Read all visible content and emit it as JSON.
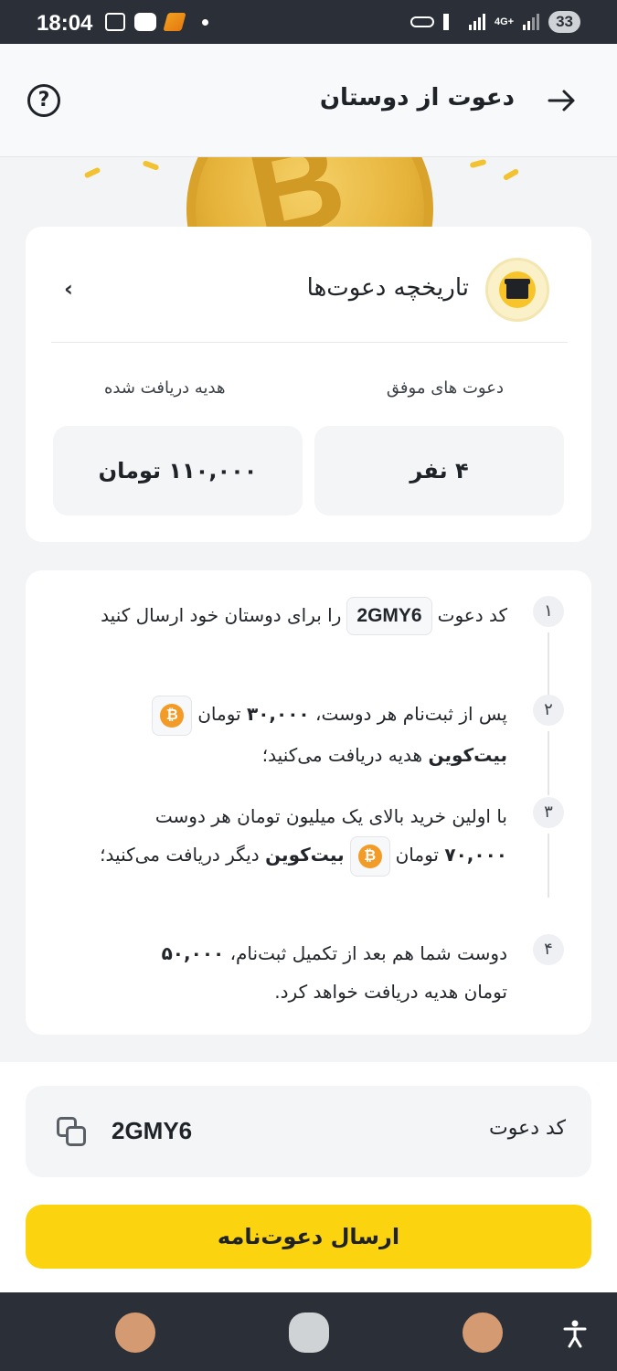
{
  "status_bar": {
    "time": "18:04",
    "network": "4G+",
    "battery": "33"
  },
  "header": {
    "title": "دعوت از دوستان",
    "back_icon": "arrow-right-icon",
    "help_icon": "question-circle-icon"
  },
  "history": {
    "title": "تاریخچه دعوت‌ها",
    "icon": "gift-icon",
    "stats": {
      "successful_label": "دعوت های موفق",
      "successful_value": "۴ نفر",
      "received_label": "هدیه دریافت شده",
      "received_value": "۱۱۰,۰۰۰ تومان"
    }
  },
  "steps": [
    {
      "num": "۱",
      "part1": "کد دعوت",
      "code": "2GMY6",
      "part2": "را برای دوستان خود ارسال کنید"
    },
    {
      "num": "۲",
      "part1": "پس از ثبت‌نام هر دوست،",
      "amount": "۳۰,۰۰۰",
      "part2": "تومان",
      "coin": "بیت‌کوین",
      "part3": "هدیه دریافت می‌کنید؛"
    },
    {
      "num": "۳",
      "part1": "با اولین خرید بالای یک میلیون تومان هر دوست",
      "amount": "۷۰,۰۰۰",
      "part2": "تومان",
      "coin": "بیت‌کوین",
      "part3": "دیگر دریافت می‌کنید؛"
    },
    {
      "num": "۴",
      "part1": "دوست شما هم بعد از تکمیل ثبت‌نام،",
      "amount": "۵۰,۰۰۰",
      "part2": "تومان هدیه دریافت خواهد کرد."
    }
  ],
  "invite_code": {
    "label": "کد دعوت",
    "value": "2GMY6",
    "copy_icon": "copy-icon"
  },
  "send_button": "ارسال دعوت‌نامه",
  "colors": {
    "accent": "#fbd30f",
    "bitcoin": "#f29b27",
    "text": "#1f2328"
  }
}
